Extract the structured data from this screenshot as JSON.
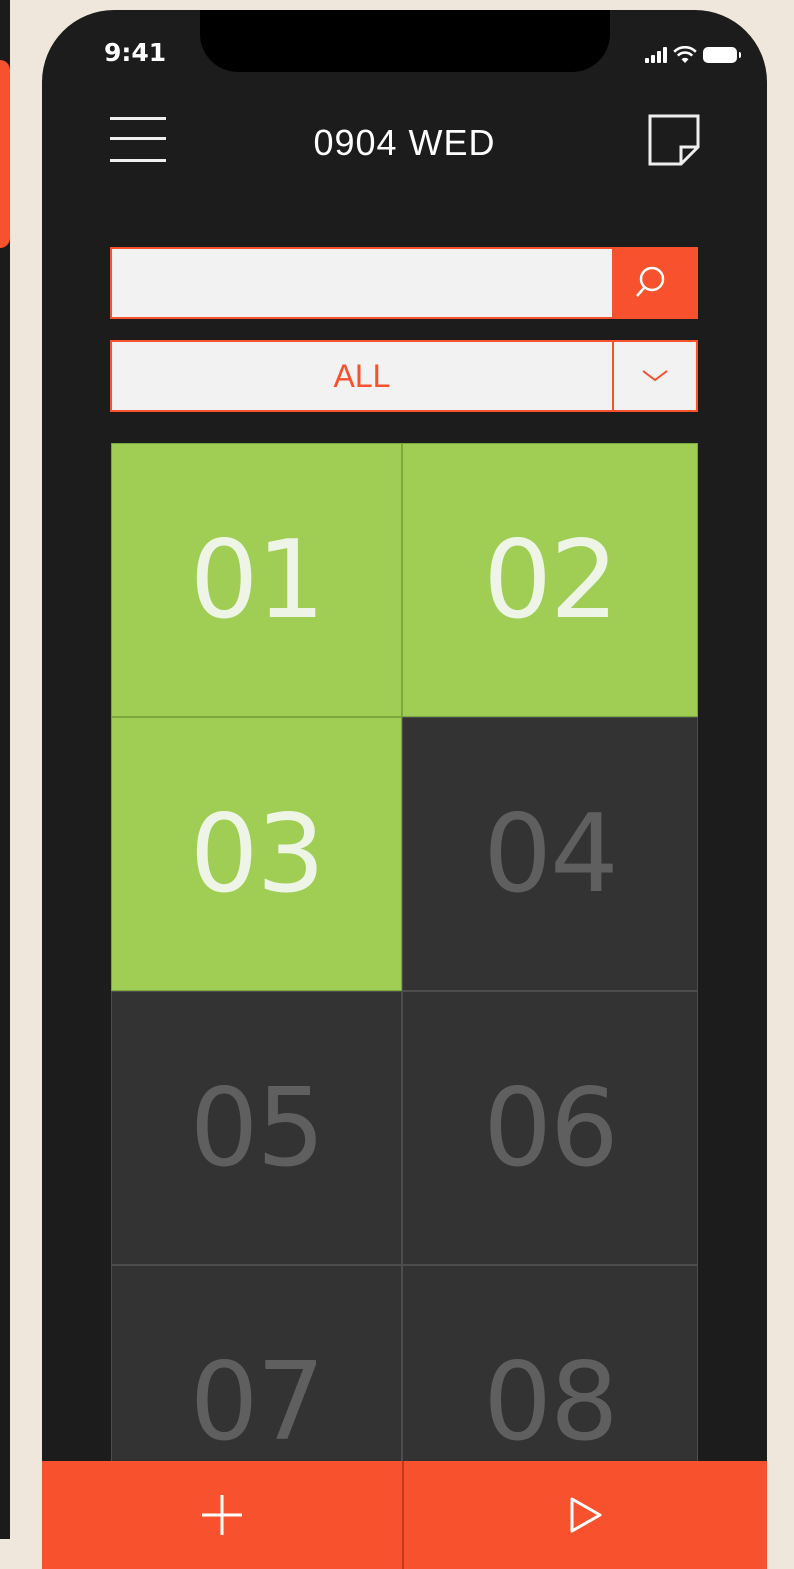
{
  "status_bar": {
    "time": "9:41"
  },
  "header": {
    "title": "0904 WED"
  },
  "search": {
    "value": "",
    "placeholder": ""
  },
  "filter": {
    "selected": "ALL"
  },
  "grid": {
    "cells": [
      {
        "label": "01",
        "active": true
      },
      {
        "label": "02",
        "active": true
      },
      {
        "label": "03",
        "active": true
      },
      {
        "label": "04",
        "active": false
      },
      {
        "label": "05",
        "active": false
      },
      {
        "label": "06",
        "active": false
      },
      {
        "label": "07",
        "active": false
      },
      {
        "label": "08",
        "active": false
      }
    ]
  },
  "icons": {
    "menu": "hamburger-menu-icon",
    "note": "sticky-note-icon",
    "search": "search-icon",
    "chevron": "chevron-down-icon",
    "add": "plus-icon",
    "play": "play-icon"
  },
  "colors": {
    "accent": "#f7512d",
    "active_cell": "#a0ce55",
    "inactive_cell": "#333333",
    "background": "#1c1c1c"
  }
}
